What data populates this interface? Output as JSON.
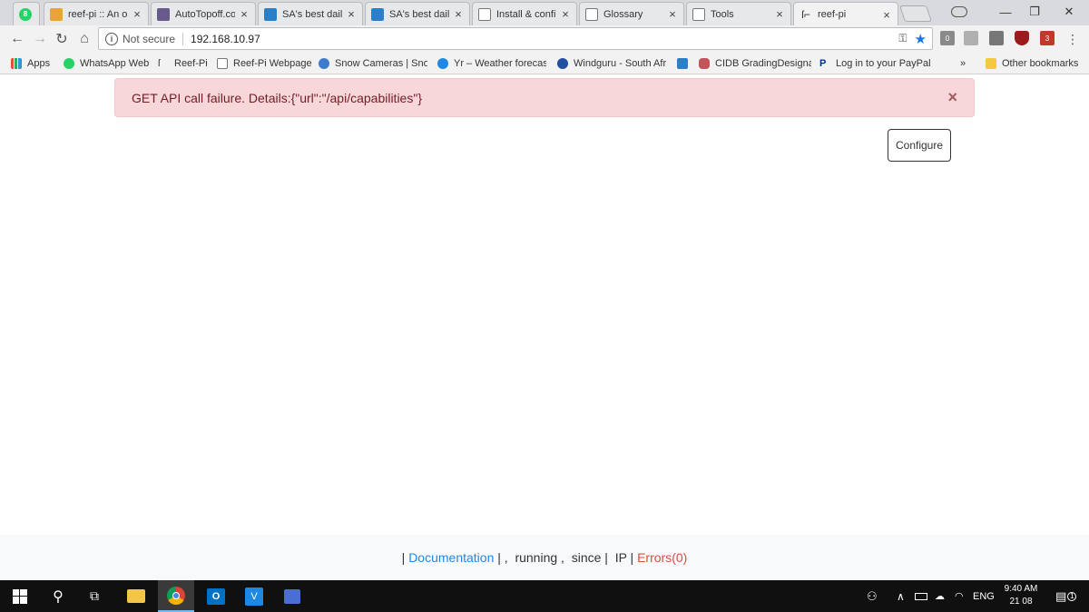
{
  "tabs": [
    {
      "title": "",
      "favicon": "whatsapp-icon",
      "color": "#25d366",
      "badge": "8"
    },
    {
      "title": "reef-pi :: An op",
      "favicon": "document-icon",
      "color": "#e8a33d"
    },
    {
      "title": "AutoTopoff.co",
      "favicon": "site-icon",
      "color": "#6a5a8c"
    },
    {
      "title": "SA's best daily",
      "favicon": "daily-icon",
      "color": "#2b7fc9"
    },
    {
      "title": "SA's best daily",
      "favicon": "daily-icon",
      "color": "#2b7fc9"
    },
    {
      "title": "Install & confi",
      "favicon": "page-icon",
      "color": "#ffffff"
    },
    {
      "title": "Glossary",
      "favicon": "page-icon",
      "color": "#ffffff"
    },
    {
      "title": "Tools",
      "favicon": "page-icon",
      "color": "#ffffff"
    },
    {
      "title": "reef-pi",
      "favicon": "reefpi-icon",
      "color": "#ffffff"
    }
  ],
  "toolbar": {
    "security_label": "Not secure",
    "url": "192.168.10.97",
    "ext_badge_1": "0",
    "ext_badge_2": "3"
  },
  "bookmarks": [
    {
      "label": "Apps",
      "icon": "apps-grid-icon",
      "color": "#e74c3c"
    },
    {
      "label": "WhatsApp Web",
      "icon": "whatsapp-icon",
      "color": "#25d366"
    },
    {
      "label": "Reef-Pi",
      "icon": "reefpi-icon",
      "color": "#ffffff"
    },
    {
      "label": "Reef-Pi Webpage",
      "icon": "page-icon",
      "color": "#ffffff"
    },
    {
      "label": "Snow Cameras | Snov",
      "icon": "snowflake-icon",
      "color": "#3d7ccc"
    },
    {
      "label": "Yr – Weather forecast",
      "icon": "yr-icon",
      "color": "#1e88e5"
    },
    {
      "label": "Windguru - South Afr",
      "icon": "windguru-icon",
      "color": "#1e4fa0"
    },
    {
      "label": "",
      "icon": "daily-icon",
      "color": "#2b7fc9"
    },
    {
      "label": "CIDB GradingDesigna",
      "icon": "cidb-icon",
      "color": "#c0555a"
    },
    {
      "label": "Log in to your PayPal",
      "icon": "paypal-icon",
      "color": "#003087"
    }
  ],
  "bookmarks_overflow": "»",
  "other_bookmarks": "Other bookmarks",
  "alert": {
    "message": "GET API call failure. Details:{\"url\":\"/api/capabilities\"}",
    "close": "×"
  },
  "configure_label": "Configure",
  "footer": {
    "sep1": "| ",
    "documentation": "Documentation",
    "middle": " | ,  running ,  since |  IP | ",
    "errors": "Errors(0)"
  },
  "taskbar": {
    "time": "9:40 AM",
    "date": "21 08",
    "language": "ENG",
    "notification_count": "1"
  }
}
